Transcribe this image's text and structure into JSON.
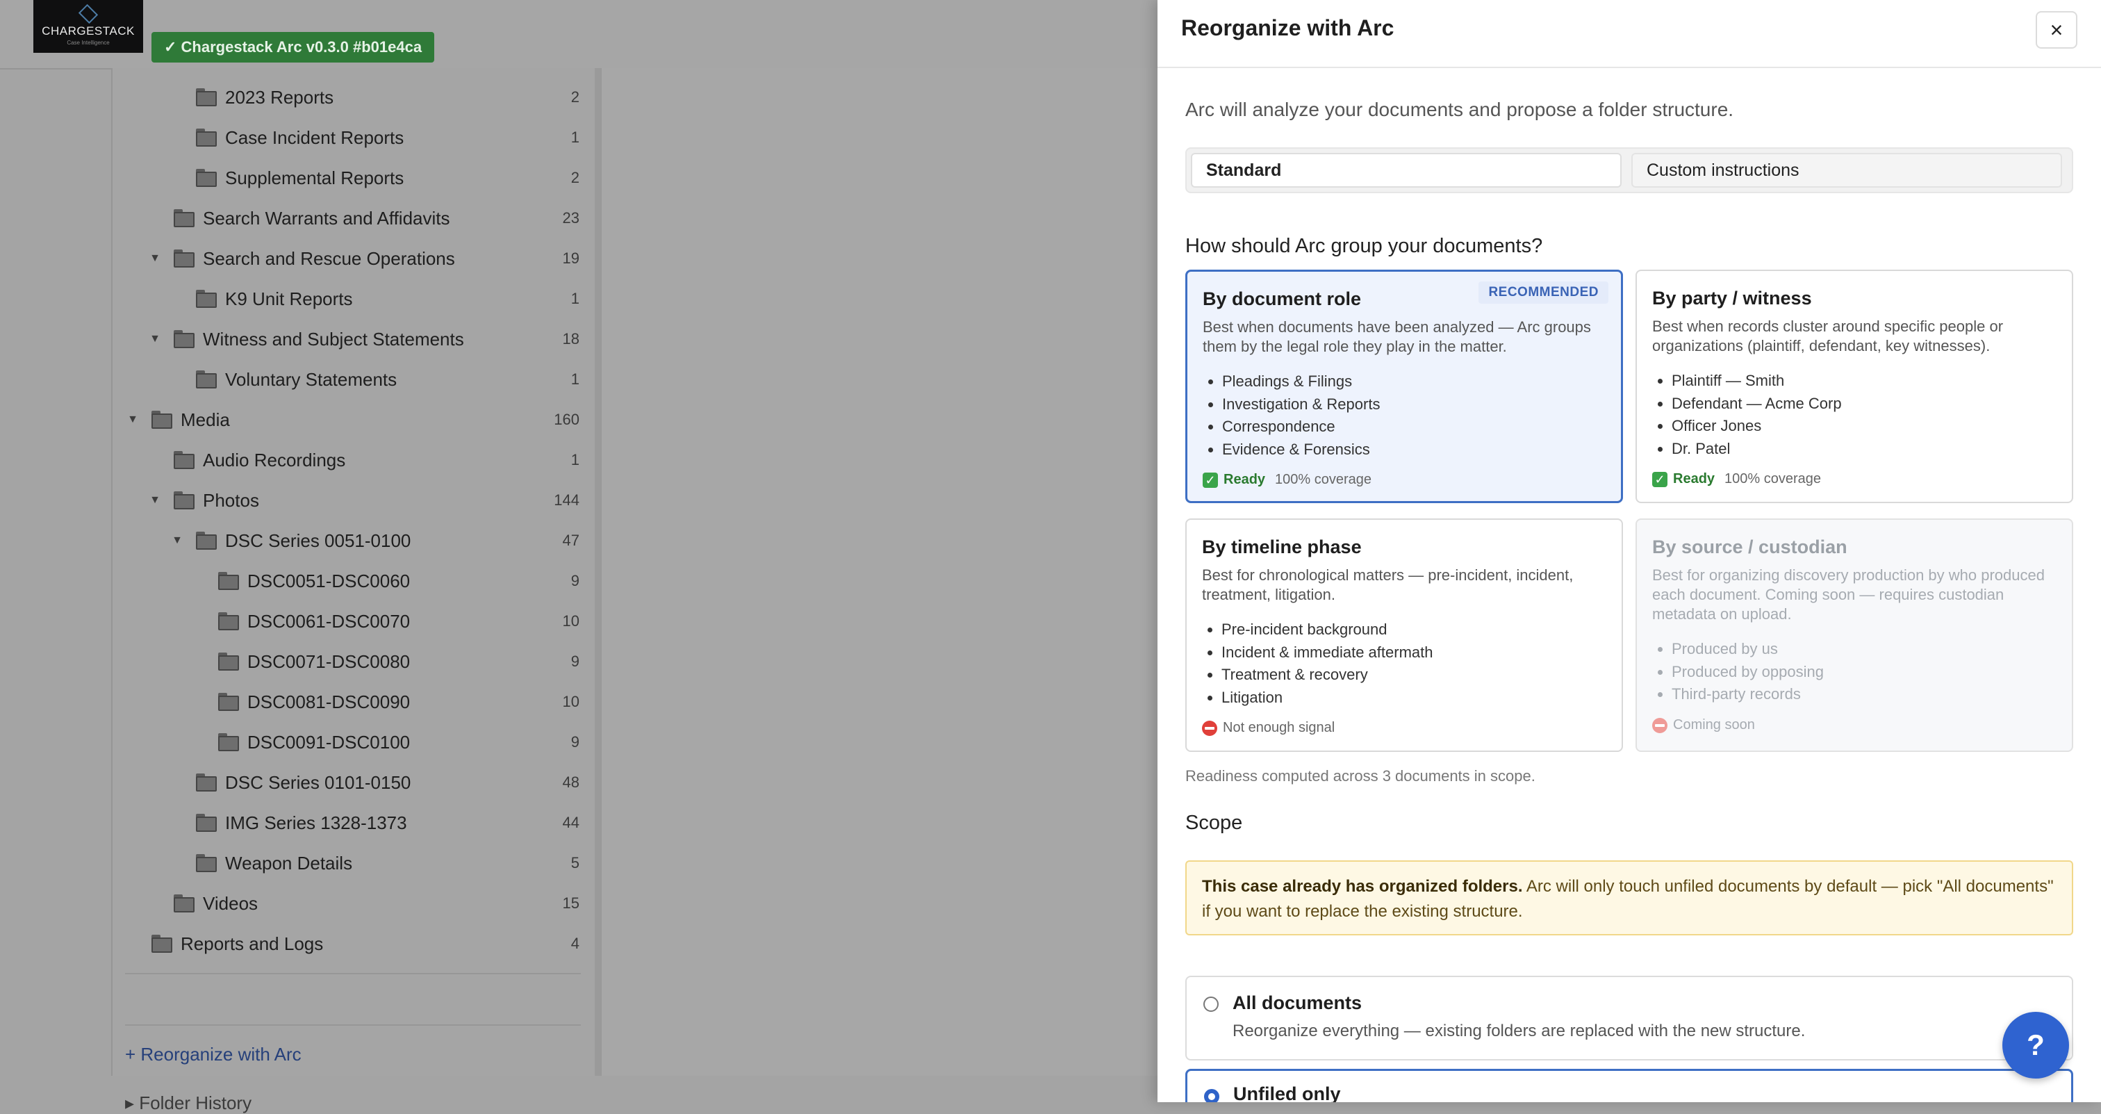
{
  "app": {
    "logo_text": "CHARGESTACK",
    "logo_sub": "Case Intelligence",
    "version_badge": "✓ Chargestack Arc v0.3.0 #b01e4ca"
  },
  "tree": {
    "rows": [
      {
        "label": "2023 Reports",
        "count": "2"
      },
      {
        "label": "Case Incident Reports",
        "count": "1"
      },
      {
        "label": "Supplemental Reports",
        "count": "2"
      },
      {
        "label": "Search Warrants and Affidavits",
        "count": "23"
      },
      {
        "label": "Search and Rescue Operations",
        "count": "19"
      },
      {
        "label": "K9 Unit Reports",
        "count": "1"
      },
      {
        "label": "Witness and Subject Statements",
        "count": "18"
      },
      {
        "label": "Voluntary Statements",
        "count": "1"
      },
      {
        "label": "Media",
        "count": "160"
      },
      {
        "label": "Audio Recordings",
        "count": "1"
      },
      {
        "label": "Photos",
        "count": "144"
      },
      {
        "label": "DSC Series 0051-0100",
        "count": "47"
      },
      {
        "label": "DSC0051-DSC0060",
        "count": "9"
      },
      {
        "label": "DSC0061-DSC0070",
        "count": "10"
      },
      {
        "label": "DSC0071-DSC0080",
        "count": "9"
      },
      {
        "label": "DSC0081-DSC0090",
        "count": "10"
      },
      {
        "label": "DSC0091-DSC0100",
        "count": "9"
      },
      {
        "label": "DSC Series 0101-0150",
        "count": "48"
      },
      {
        "label": "IMG Series 1328-1373",
        "count": "44"
      },
      {
        "label": "Weapon Details",
        "count": "5"
      },
      {
        "label": "Videos",
        "count": "15"
      },
      {
        "label": "Reports and Logs",
        "count": "4"
      }
    ],
    "reorganize_link": "+ Reorganize with Arc",
    "history_link": "▸ Folder History"
  },
  "drawer": {
    "title": "Reorganize with Arc",
    "close_label": "×",
    "intro": "Arc will analyze your documents and propose a folder structure.",
    "tabs": {
      "standard": "Standard",
      "custom": "Custom instructions"
    },
    "group_heading": "How should Arc group your documents?",
    "cards": {
      "role": {
        "title": "By document role",
        "badge": "RECOMMENDED",
        "desc": "Best when documents have been analyzed — Arc groups them by the legal role they play in the matter.",
        "items": [
          "Pleadings & Filings",
          "Investigation & Reports",
          "Correspondence",
          "Evidence & Forensics"
        ],
        "status": "Ready",
        "coverage": "100% coverage"
      },
      "party": {
        "title": "By party / witness",
        "desc": "Best when records cluster around specific people or organizations (plaintiff, defendant, key witnesses).",
        "items": [
          "Plaintiff — Smith",
          "Defendant — Acme Corp",
          "Officer Jones",
          "Dr. Patel"
        ],
        "status": "Ready",
        "coverage": "100% coverage"
      },
      "timeline": {
        "title": "By timeline phase",
        "desc": "Best for chronological matters — pre-incident, incident, treatment, litigation.",
        "items": [
          "Pre-incident background",
          "Incident & immediate aftermath",
          "Treatment & recovery",
          "Litigation"
        ],
        "status": "Not enough signal"
      },
      "source": {
        "title": "By source / custodian",
        "desc": "Best for organizing discovery production by who produced each document. Coming soon — requires custodian metadata on upload.",
        "items": [
          "Produced by us",
          "Produced by opposing",
          "Third-party records"
        ],
        "status": "Coming soon"
      }
    },
    "readiness_note": "Readiness computed across 3 documents in scope.",
    "scope_heading": "Scope",
    "notice_strong": "This case already has organized folders.",
    "notice_rest": " Arc will only touch unfiled documents by default — pick \"All documents\" if you want to replace the existing structure.",
    "scope_all": {
      "title": "All documents",
      "desc": "Reorganize everything — existing folders are replaced with the new structure."
    },
    "scope_unfiled": {
      "title": "Unfiled only"
    },
    "help_label": "?"
  },
  "colors": {
    "accent": "#3e6fc4",
    "badge_green": "#2f7a38",
    "ready_green": "#2a7a2f",
    "notice_bg": "#fef8e4",
    "fab_blue": "#2f63d0"
  }
}
